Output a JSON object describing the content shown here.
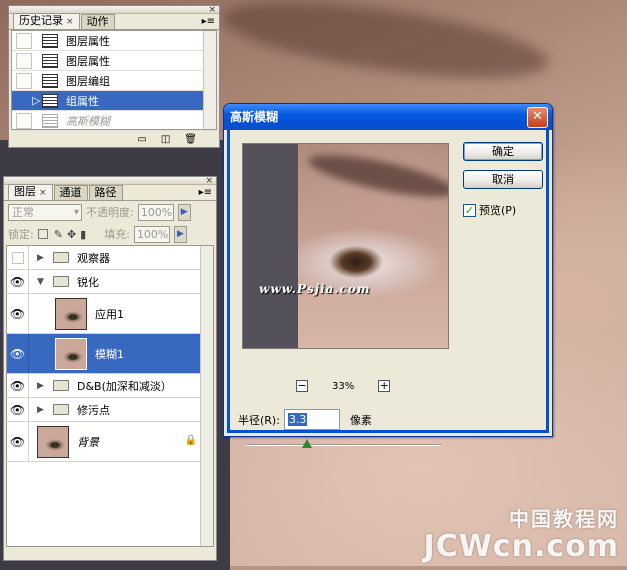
{
  "history": {
    "tabs": [
      "历史记录",
      "动作"
    ],
    "close_glyph": "×",
    "items": [
      {
        "label": "图层属性",
        "state": "normal"
      },
      {
        "label": "图层属性",
        "state": "normal"
      },
      {
        "label": "图层编组",
        "state": "normal"
      },
      {
        "label": "组属性",
        "state": "selected"
      },
      {
        "label": "高斯模糊",
        "state": "undone"
      }
    ]
  },
  "layers": {
    "tabs": [
      "图层",
      "通道",
      "路径"
    ],
    "blend_mode": "正常",
    "opacity_label": "不透明度:",
    "opacity_value": "100%",
    "lock_label": "锁定:",
    "fill_label": "填充:",
    "fill_value": "100%",
    "items": [
      {
        "name": "观察器",
        "kind": "group",
        "expanded": false,
        "visible": false
      },
      {
        "name": "锐化",
        "kind": "group",
        "expanded": true,
        "visible": true
      },
      {
        "name": "应用1",
        "kind": "layer",
        "visible": true
      },
      {
        "name": "模糊1",
        "kind": "layer",
        "visible": true,
        "selected": true
      },
      {
        "name": "D&B(加深和减淡）",
        "kind": "group",
        "expanded": false,
        "visible": true
      },
      {
        "name": "修污点",
        "kind": "group",
        "expanded": false,
        "visible": true
      },
      {
        "name": "背景",
        "kind": "background",
        "visible": true,
        "locked": true
      }
    ]
  },
  "dialog": {
    "title": "高斯模糊",
    "ok_label": "确定",
    "cancel_label": "取消",
    "preview_label": "预览(P)",
    "preview_checked": true,
    "zoom": "33%",
    "radius_label": "半径(R):",
    "radius_value": "3.3",
    "radius_unit": "像素",
    "preview_watermark": "www.Psjia.com"
  },
  "watermark": {
    "cn": "中国教程网",
    "en": "JCWcn.com"
  },
  "colors": {
    "selection": "#3968c0",
    "titlebar": "#0450d5",
    "panel": "#ece9d8"
  }
}
